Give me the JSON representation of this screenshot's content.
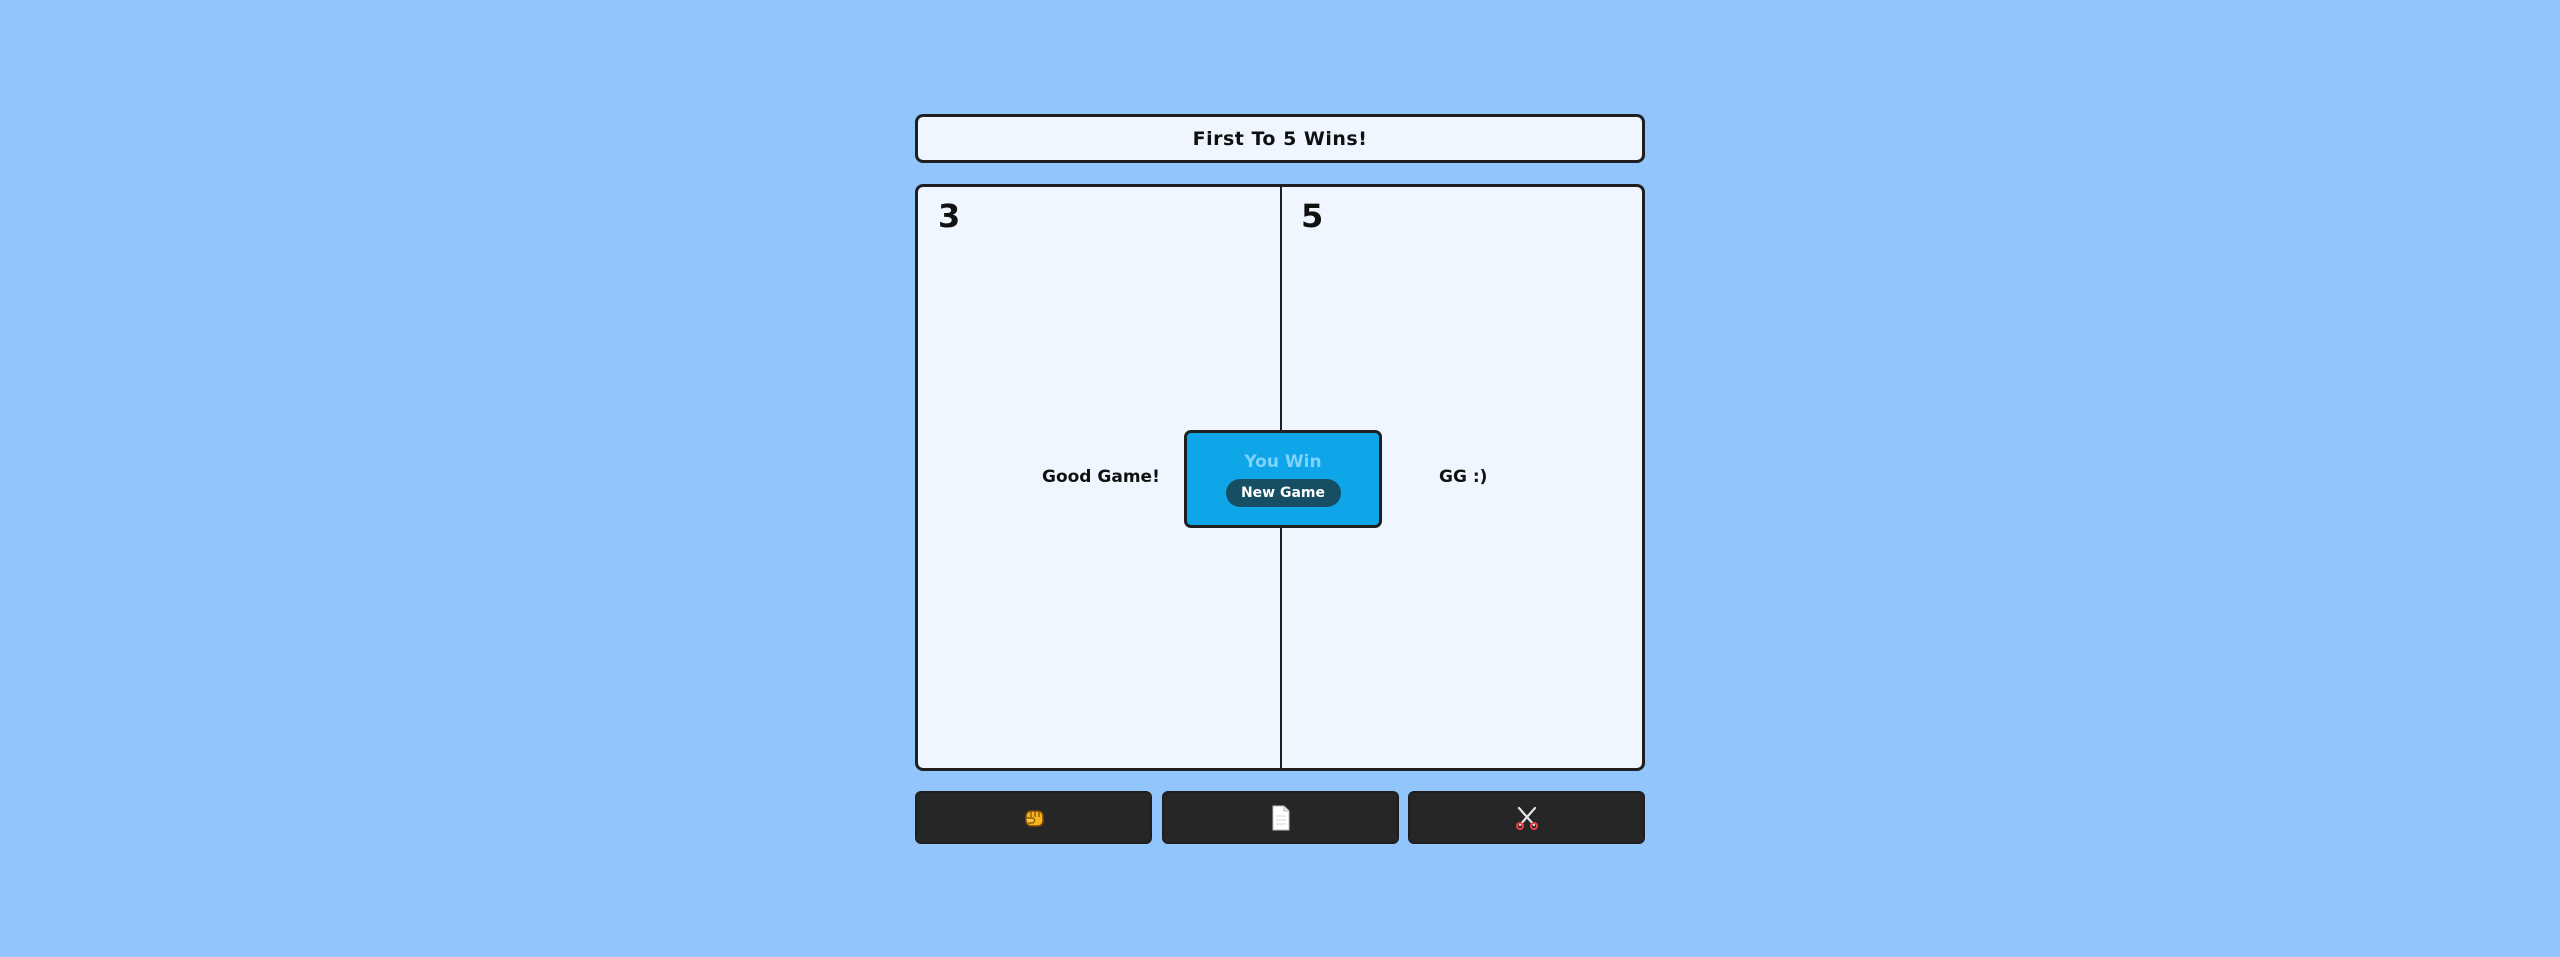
{
  "header": {
    "title": "First To 5 Wins!"
  },
  "scoreboard": {
    "player_score": "3",
    "computer_score": "5",
    "player_message": "Good Game!",
    "computer_message": "GG :)"
  },
  "result_modal": {
    "result_text": "You Win",
    "new_game_label": "New Game"
  },
  "choices": [
    {
      "name": "rock",
      "icon": "fist-icon"
    },
    {
      "name": "paper",
      "icon": "page-icon"
    },
    {
      "name": "scissors",
      "icon": "scissors-icon"
    }
  ],
  "colors": {
    "background": "#93c5fd",
    "panel": "#eff6ff",
    "modal": "#0ea5e9",
    "modal_text": "#7dd3fc",
    "new_game_button": "#164e63",
    "choice_button": "#262626"
  }
}
